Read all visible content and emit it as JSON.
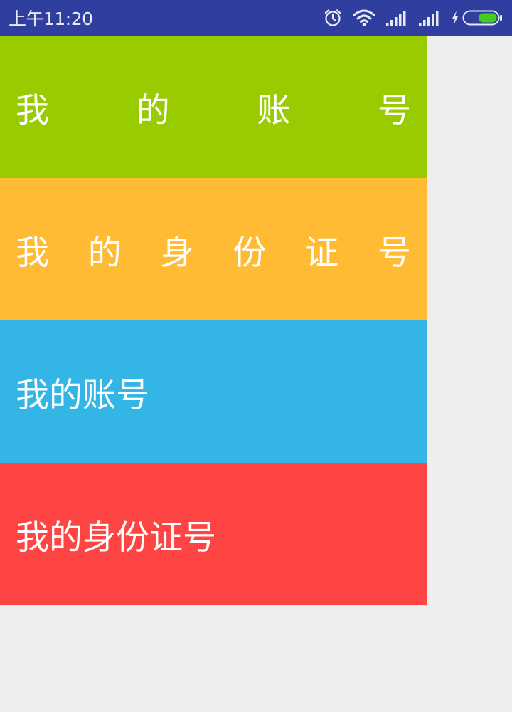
{
  "status_bar": {
    "time": "上午11:20",
    "icons": [
      "alarm-icon",
      "wifi-icon",
      "signal-icon",
      "signal-icon",
      "charging-icon",
      "battery-icon"
    ],
    "background_color": "#303f9f",
    "battery_color": "#44cc22"
  },
  "blocks": [
    {
      "text": "我的账号",
      "chars": [
        "我",
        "的",
        "账",
        "号"
      ],
      "style": "justified",
      "color": "#99cc00"
    },
    {
      "text": "我的身份证号",
      "chars": [
        "我",
        "的",
        "身",
        "份",
        "证",
        "号"
      ],
      "style": "justified",
      "color": "#ffbb33"
    },
    {
      "text": "我的账号",
      "style": "normal",
      "color": "#33b5e5"
    },
    {
      "text": "我的身份证号",
      "style": "normal",
      "color": "#ff4444"
    }
  ],
  "page_background": "#eeeeee"
}
